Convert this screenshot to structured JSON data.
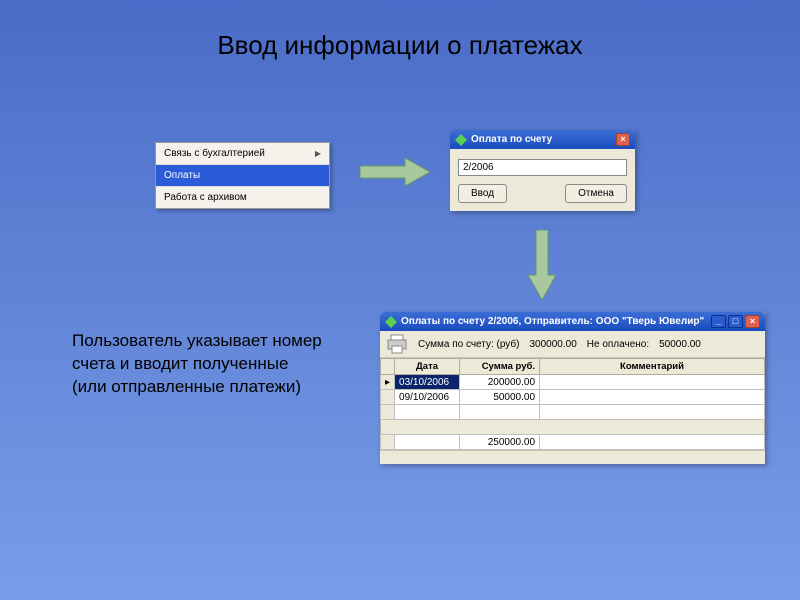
{
  "slide": {
    "title": "Ввод информации о платежах"
  },
  "menu": {
    "items": [
      {
        "label": "Связь с бухгалтерией",
        "has_submenu": true,
        "selected": false
      },
      {
        "label": "Оплаты",
        "has_submenu": false,
        "selected": true
      },
      {
        "label": "Работа с архивом",
        "has_submenu": false,
        "selected": false
      }
    ]
  },
  "dialog_input": {
    "title": "Оплата по счету",
    "value": "2/2006",
    "submit_label": "Ввод",
    "cancel_label": "Отмена"
  },
  "description": "Пользователь указывает номер счета и вводит полученные (или отправленные платежи)",
  "dialog_payments": {
    "title": "Оплаты по счету 2/2006, Отправитель: ООО \"Тверь Ювелир\"",
    "summary_label": "Сумма по счету: (руб)",
    "summary_value": "300000.00",
    "unpaid_label": "Не оплачено:",
    "unpaid_value": "50000.00",
    "columns": [
      "Дата",
      "Сумма руб.",
      "Комментарий"
    ],
    "rows": [
      {
        "date": "03/10/2006",
        "amount": "200000.00",
        "comment": "",
        "current": true,
        "selected": true
      },
      {
        "date": "09/10/2006",
        "amount": "50000.00",
        "comment": "",
        "current": false,
        "selected": false
      }
    ],
    "total_amount": "250000.00"
  },
  "colors": {
    "xp_blue": "#2b5bd6",
    "window_bg": "#ece9d8"
  }
}
